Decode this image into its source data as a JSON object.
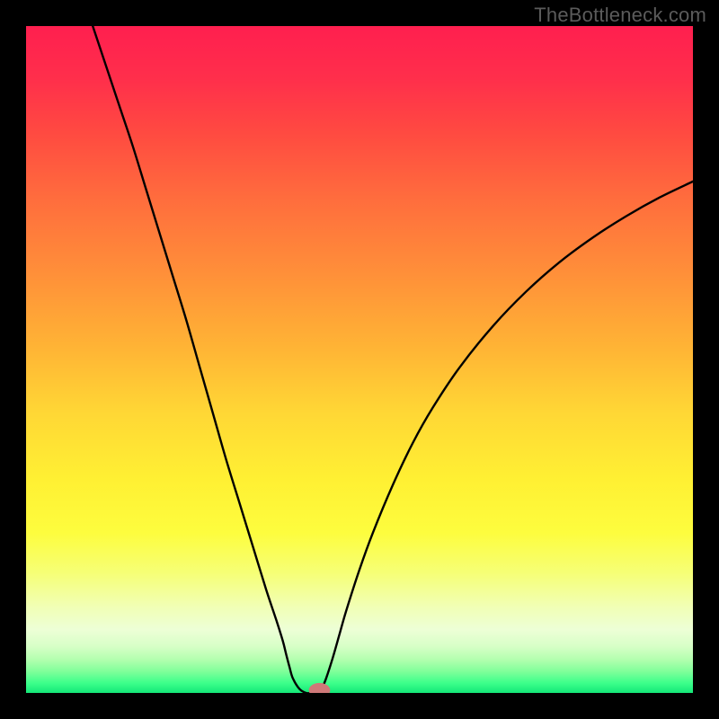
{
  "watermark": "TheBottleneck.com",
  "chart_data": {
    "type": "line",
    "title": "",
    "xlabel": "",
    "ylabel": "",
    "xlim": [
      0,
      100
    ],
    "ylim": [
      0,
      100
    ],
    "grid": false,
    "legend": false,
    "background_gradient": {
      "stops": [
        {
          "offset": 0.0,
          "color": "#ff1f4f"
        },
        {
          "offset": 0.08,
          "color": "#ff2f4b"
        },
        {
          "offset": 0.16,
          "color": "#ff4a41"
        },
        {
          "offset": 0.26,
          "color": "#ff6d3d"
        },
        {
          "offset": 0.37,
          "color": "#ff8f39"
        },
        {
          "offset": 0.48,
          "color": "#ffb335"
        },
        {
          "offset": 0.58,
          "color": "#ffd735"
        },
        {
          "offset": 0.68,
          "color": "#fff033"
        },
        {
          "offset": 0.76,
          "color": "#fdfd3e"
        },
        {
          "offset": 0.82,
          "color": "#f6ff76"
        },
        {
          "offset": 0.87,
          "color": "#f1ffb4"
        },
        {
          "offset": 0.905,
          "color": "#edffd6"
        },
        {
          "offset": 0.93,
          "color": "#d7ffc7"
        },
        {
          "offset": 0.95,
          "color": "#b3ffaf"
        },
        {
          "offset": 0.968,
          "color": "#7fff9a"
        },
        {
          "offset": 0.985,
          "color": "#3dff8b"
        },
        {
          "offset": 1.0,
          "color": "#14e878"
        }
      ]
    },
    "series": [
      {
        "name": "bottleneck-curve",
        "color": "#000000",
        "x": [
          10.0,
          12.0,
          14.0,
          16.0,
          18.0,
          20.0,
          22.0,
          24.0,
          26.0,
          28.0,
          30.0,
          32.0,
          34.0,
          36.0,
          37.5,
          38.5,
          39.0,
          39.5,
          40.0,
          41.0,
          42.0,
          43.0,
          44.0,
          44.5,
          45.0,
          46.0,
          47.0,
          48.0,
          50.0,
          52.0,
          55.0,
          58.0,
          61.0,
          65.0,
          70.0,
          75.0,
          80.0,
          85.0,
          90.0,
          95.0,
          100.0
        ],
        "y": [
          100.0,
          94.0,
          88.0,
          82.0,
          75.5,
          69.0,
          62.5,
          56.0,
          49.0,
          42.0,
          35.0,
          28.5,
          22.0,
          15.5,
          11.0,
          7.8,
          5.8,
          3.9,
          2.2,
          0.6,
          0.0,
          0.0,
          0.2,
          1.0,
          2.2,
          5.3,
          8.8,
          12.3,
          18.5,
          24.0,
          31.2,
          37.5,
          42.8,
          48.8,
          55.0,
          60.2,
          64.6,
          68.3,
          71.5,
          74.3,
          76.7
        ]
      }
    ],
    "marker": {
      "name": "optimal-point",
      "x": 44.0,
      "y": 0.4,
      "color": "#cf7878",
      "rx": 1.6,
      "ry": 1.1
    }
  }
}
